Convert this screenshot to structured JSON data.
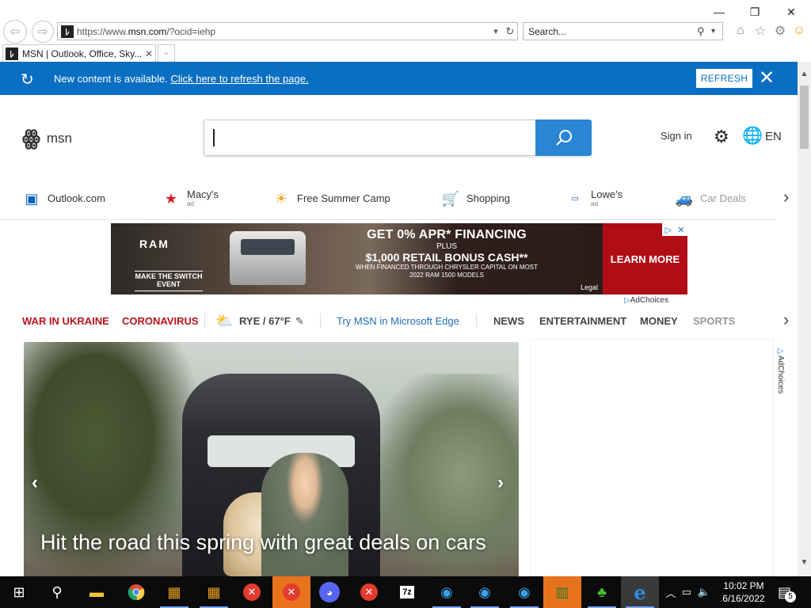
{
  "window": {
    "minimize": "—",
    "maximize": "❐",
    "close": "✕"
  },
  "browser": {
    "url_prefix": "https://www.",
    "url_domain": "msn.com",
    "url_suffix": "/?ocid=iehp",
    "search_placeholder": "Search...",
    "tab_title": "MSN | Outlook, Office, Sky...",
    "tab_close": "✕"
  },
  "notification": {
    "message": "New content is available.",
    "link": "Click here to refresh the page.",
    "refresh_button": "REFRESH",
    "close": "✕"
  },
  "header": {
    "logo_text": "msn",
    "sign_in": "Sign in",
    "language": "EN"
  },
  "quick_links": [
    {
      "label": "Outlook.com",
      "ad": ""
    },
    {
      "label": "Macy's",
      "ad": "ad"
    },
    {
      "label": "Free Summer Camp",
      "ad": ""
    },
    {
      "label": "Shopping",
      "ad": ""
    },
    {
      "label": "Lowe's",
      "ad": "ad"
    },
    {
      "label": "Car Deals",
      "ad": ""
    }
  ],
  "ad_banner": {
    "brand": "RAM",
    "tagline": "MAKE THE SWITCH EVENT",
    "line1": "GET 0% APR* FINANCING",
    "line2": "PLUS",
    "line3": "$1,000 RETAIL BONUS CASH**",
    "line4": "WHEN FINANCED THROUGH CHRYSLER CAPITAL ON MOST 2022 RAM 1500 MODELS",
    "cta": "LEARN MORE",
    "legal": "Legal",
    "adchoices": "AdChoices"
  },
  "nav": {
    "war": "WAR IN UKRAINE",
    "corona": "CORONAVIRUS",
    "weather": "RYE / 67°F",
    "edge": "Try MSN in Microsoft Edge",
    "news": "NEWS",
    "entertainment": "ENTERTAINMENT",
    "money": "MONEY",
    "sports": "SPORTS"
  },
  "hero": {
    "headline": "Hit the road this spring with great deals on cars"
  },
  "side_ad": {
    "adchoices": "AdChoices"
  },
  "taskbar": {
    "time": "10:02 PM",
    "date": "6/16/2022",
    "notifications": "5"
  }
}
